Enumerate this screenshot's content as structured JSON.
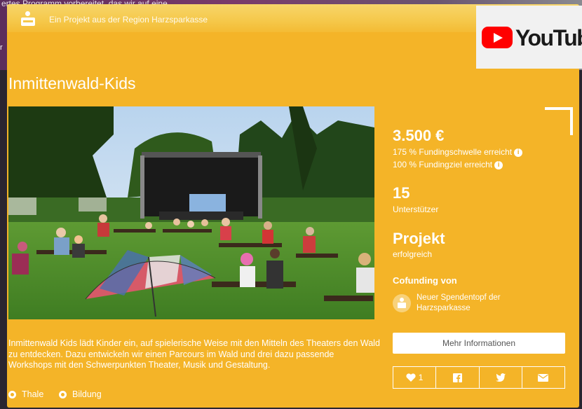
{
  "background": {
    "behind_text": "ertes Programm vorbereitet, das wir auf eine",
    "behind_side": "r"
  },
  "header": {
    "region_text": "Ein Projekt aus der Region Harzsparkasse"
  },
  "youtube": {
    "label": "YouTube"
  },
  "project": {
    "title": "Inmittenwald-Kids",
    "description": "Inmittenwald Kids lädt Kinder ein, auf spielerische Weise mit den Mitteln des Theaters den Wald zu entdecken. Dazu entwickeln wir einen Parcours im Wald und drei dazu passende Workshops mit den Schwerpunkten Theater, Musik und Gestaltung.",
    "tags": [
      "Thale",
      "Bildung"
    ]
  },
  "stats": {
    "amount": "3.500 €",
    "funding_threshold": "175 % Fundingschwelle erreicht",
    "funding_goal": "100 % Fundingziel erreicht",
    "supporters_count": "15",
    "supporters_label": "Unterstützer",
    "status_title": "Projekt",
    "status_value": "erfolgreich"
  },
  "cofunding": {
    "heading": "Cofunding von",
    "name": "Neuer Spendentopf der Harzsparkasse"
  },
  "actions": {
    "more_info": "Mehr Informationen",
    "likes": "1"
  },
  "colors": {
    "card": "#f4b428",
    "youtube_red": "#ff0000"
  }
}
